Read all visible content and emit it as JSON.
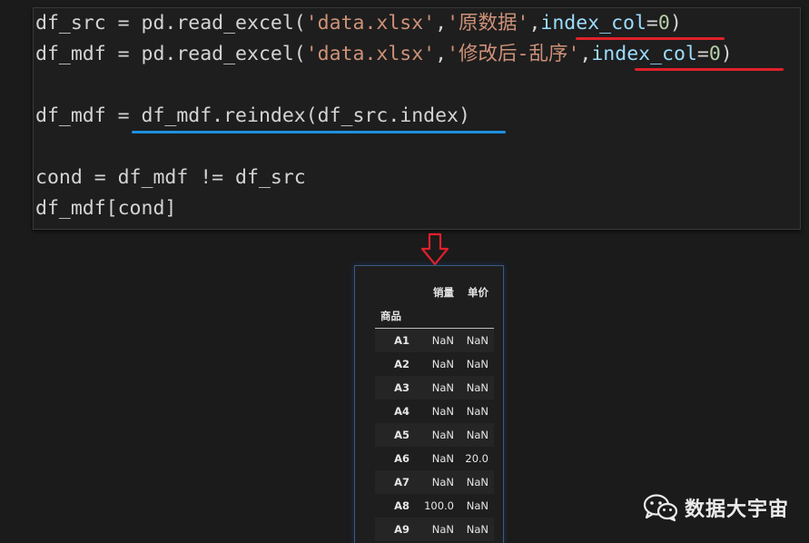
{
  "code_cell": {
    "lines": [
      {
        "a": "df_src = pd.read_excel(",
        "b": "'data.xlsx'",
        "c": ",",
        "d": "'原数据'",
        "e": ",",
        "f": "index_col",
        "g": "=",
        "h": "0",
        "i": ")"
      },
      {
        "a": "df_mdf = pd.read_excel(",
        "b": "'data.xlsx'",
        "c": ",",
        "d": "'修改后-乱序'",
        "e": ",",
        "f": "index_col",
        "g": "=",
        "h": "0",
        "i": ")"
      },
      {
        "text": ""
      },
      {
        "text": "df_mdf = df_mdf.reindex(df_src.index)"
      },
      {
        "text": ""
      },
      {
        "text": "cond = df_mdf != df_src"
      },
      {
        "text": "df_mdf[cond]"
      }
    ]
  },
  "output": {
    "columns": [
      "销量",
      "单价"
    ],
    "index_name": "商品",
    "rows": [
      {
        "idx": "A1",
        "v1": "NaN",
        "v2": "NaN"
      },
      {
        "idx": "A2",
        "v1": "NaN",
        "v2": "NaN"
      },
      {
        "idx": "A3",
        "v1": "NaN",
        "v2": "NaN"
      },
      {
        "idx": "A4",
        "v1": "NaN",
        "v2": "NaN"
      },
      {
        "idx": "A5",
        "v1": "NaN",
        "v2": "NaN"
      },
      {
        "idx": "A6",
        "v1": "NaN",
        "v2": "20.0"
      },
      {
        "idx": "A7",
        "v1": "NaN",
        "v2": "NaN"
      },
      {
        "idx": "A8",
        "v1": "100.0",
        "v2": "NaN"
      },
      {
        "idx": "A9",
        "v1": "NaN",
        "v2": "NaN"
      }
    ]
  },
  "watermark": {
    "icon": "wechat-icon",
    "text": "数据大宇宙"
  },
  "colors": {
    "string": "#ce9178",
    "keyword_arg": "#9cdcfe",
    "number": "#b5cea8",
    "underline_red": "#e0202a",
    "underline_blue": "#1e90e0",
    "arrow": "#e0202a"
  }
}
